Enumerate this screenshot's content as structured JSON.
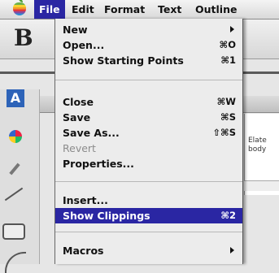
{
  "menubar": {
    "items": [
      {
        "label": "File"
      },
      {
        "label": "Edit"
      },
      {
        "label": "Format"
      },
      {
        "label": "Text"
      },
      {
        "label": "Outline"
      }
    ]
  },
  "toolbar": {
    "text_style_glyph": "B"
  },
  "document": {
    "line1": "Elate",
    "line2": "body"
  },
  "file_menu": {
    "items": [
      {
        "label": "New",
        "shortcut": ""
      },
      {
        "label": "Open...",
        "shortcut": "⌘O"
      },
      {
        "label": "Show Starting Points",
        "shortcut": "⌘1"
      },
      {
        "label": "Close",
        "shortcut": "⌘W"
      },
      {
        "label": "Save",
        "shortcut": "⌘S"
      },
      {
        "label": "Save As...",
        "shortcut": "⇧⌘S"
      },
      {
        "label": "Revert",
        "shortcut": ""
      },
      {
        "label": "Properties...",
        "shortcut": ""
      },
      {
        "label": "Insert...",
        "shortcut": ""
      },
      {
        "label": "Show Clippings",
        "shortcut": "⌘2"
      },
      {
        "label": "Macros",
        "shortcut": ""
      }
    ]
  },
  "tools": {
    "text_tool_glyph": "A"
  },
  "colors": {
    "highlight": "#2a26a3"
  }
}
